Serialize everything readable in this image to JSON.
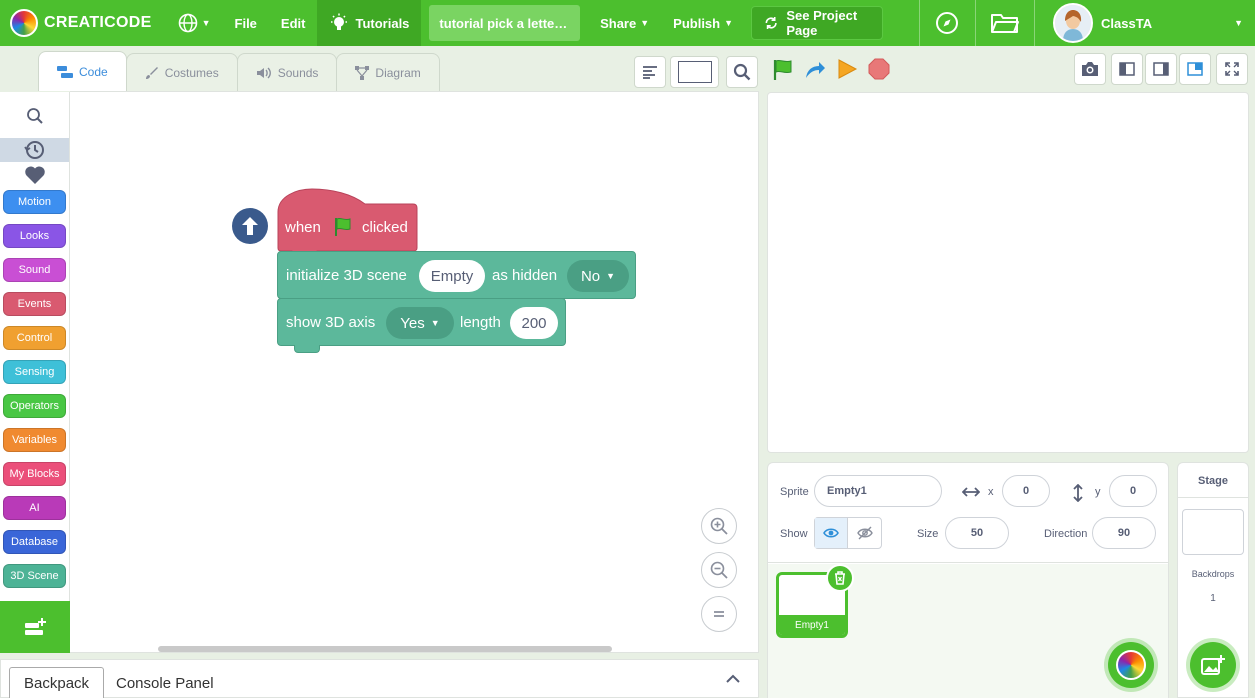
{
  "menubar": {
    "brand": "CREATICODE",
    "file": "File",
    "edit": "Edit",
    "tutorials": "Tutorials",
    "project_title": "tutorial pick a letter step ...",
    "share": "Share",
    "publish": "Publish",
    "see_project": "See Project Page",
    "user": "ClassTA"
  },
  "tabs": {
    "code": "Code",
    "costumes": "Costumes",
    "sounds": "Sounds",
    "diagram": "Diagram"
  },
  "categories": [
    {
      "label": "Motion",
      "color": "#3d8ff0"
    },
    {
      "label": "Looks",
      "color": "#8a55e6"
    },
    {
      "label": "Sound",
      "color": "#c94fd4"
    },
    {
      "label": "Events",
      "color": "#d95a70"
    },
    {
      "label": "Control",
      "color": "#f0a030"
    },
    {
      "label": "Sensing",
      "color": "#3ec0d8"
    },
    {
      "label": "Operators",
      "color": "#49c744"
    },
    {
      "label": "Variables",
      "color": "#f08a30"
    },
    {
      "label": "My Blocks",
      "color": "#eb4f7a"
    },
    {
      "label": "AI",
      "color": "#b93ab8"
    },
    {
      "label": "Database",
      "color": "#3a66d8"
    },
    {
      "label": "3D Scene",
      "color": "#4db396"
    }
  ],
  "blocks": {
    "hat_when": "when",
    "hat_clicked": "clicked",
    "init_label": "initialize 3D scene",
    "init_scene": "Empty",
    "init_hidden_label": "as hidden",
    "init_hidden_value": "No",
    "axis_label": "show 3D axis",
    "axis_value": "Yes",
    "axis_length_label": "length",
    "axis_length_value": "200"
  },
  "bottom": {
    "backpack": "Backpack",
    "console": "Console Panel"
  },
  "sprite": {
    "sprite_label": "Sprite",
    "sprite_name": "Empty1",
    "x_label": "x",
    "x": "0",
    "y_label": "y",
    "y": "0",
    "show_label": "Show",
    "size_label": "Size",
    "size": "50",
    "direction_label": "Direction",
    "direction": "90",
    "card_name": "Empty1"
  },
  "stage_pane": {
    "title": "Stage",
    "backdrops_label": "Backdrops",
    "backdrops_count": "1"
  },
  "colors": {
    "brand_green": "#4cbf2e",
    "event_block": "#d95a70",
    "scene_block": "#5cb89b"
  }
}
